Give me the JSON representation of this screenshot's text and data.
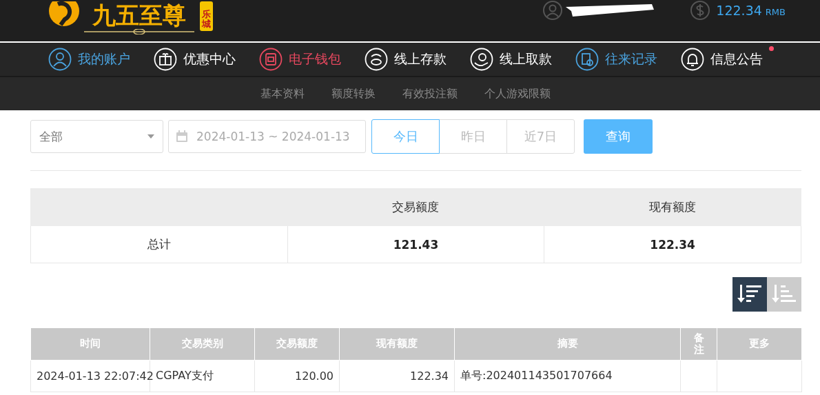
{
  "header": {
    "logo": {
      "title": "九五至尊",
      "badge": "乐城"
    },
    "balance": {
      "amount": "122.34",
      "unit": "RMB"
    }
  },
  "nav": [
    {
      "label": "我的账户",
      "color": "#4aa3df",
      "dot": false
    },
    {
      "label": "优惠中心",
      "color": "#ffffff",
      "dot": false
    },
    {
      "label": "电子钱包",
      "color": "#e8485f",
      "dot": false
    },
    {
      "label": "线上存款",
      "color": "#ffffff",
      "dot": false
    },
    {
      "label": "线上取款",
      "color": "#ffffff",
      "dot": false
    },
    {
      "label": "往来记录",
      "color": "#4aa3df",
      "dot": false
    },
    {
      "label": "信息公告",
      "color": "#ffffff",
      "dot": true
    }
  ],
  "subnav": [
    "基本资料",
    "额度转换",
    "有效投注额",
    "个人游戏限额"
  ],
  "filter": {
    "type_select": "全部",
    "date_range": "2024-01-13 ~ 2024-01-13",
    "quick": [
      {
        "label": "今日",
        "selected": true
      },
      {
        "label": "昨日",
        "selected": false
      },
      {
        "label": "近7日",
        "selected": false
      }
    ],
    "query_button": "查询"
  },
  "summary": {
    "columns": [
      "交易额度",
      "现有额度"
    ],
    "row": {
      "label": "总计",
      "values": [
        "121.43",
        "122.34"
      ]
    }
  },
  "sort": [
    {
      "kind": "desc",
      "selected": true
    },
    {
      "kind": "asc",
      "selected": false
    }
  ],
  "table": {
    "columns": [
      "时间",
      "交易类别",
      "交易额度",
      "现有额度",
      "摘要",
      "备注",
      "更多"
    ],
    "rows": [
      [
        "2024-01-13 22:07:42",
        "CGPAY支付",
        "120.00",
        "122.34",
        "单号:202401143501707664",
        "",
        ""
      ]
    ]
  }
}
